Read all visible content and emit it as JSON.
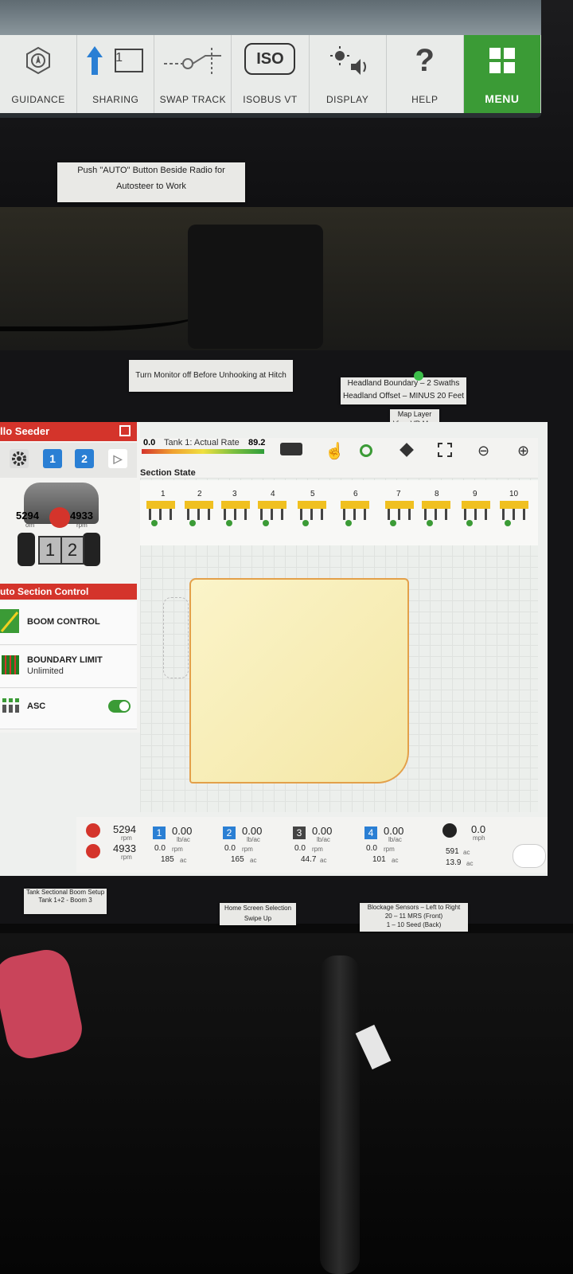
{
  "top_toolbar": {
    "buttons": [
      {
        "label": "GUIDANCE",
        "icon": "guidance-compass-icon"
      },
      {
        "label": "SHARING",
        "icon": "sharing-arrow-icon",
        "badge": "1"
      },
      {
        "label": "SWAP TRACK",
        "icon": "swap-track-icon"
      },
      {
        "label": "ISOBUS VT",
        "icon": "iso-icon",
        "icon_text": "ISO"
      },
      {
        "label": "DISPLAY",
        "icon": "display-brightness-icon"
      },
      {
        "label": "HELP",
        "icon": "help-question-icon",
        "icon_text": "?"
      },
      {
        "label": "MENU",
        "icon": "menu-grid-icon"
      }
    ]
  },
  "sticky_notes": {
    "autosteer_line1": "Push \"AUTO\" Button Beside Radio for",
    "autosteer_line2": "Autosteer to Work",
    "monitor_note": "Turn Monitor off Before Unhooking at Hitch",
    "headland_line1": "Headland Boundary – 2 Swaths",
    "headland_line2": "Headland Offset – MINUS 20 Feet",
    "map_layer_line1": "Map Layer",
    "map_layer_line2": "View VR Map",
    "tank_setup_line1": "Tank Sectional Boom Setup",
    "tank_setup_line2": "Tank 1+2  - Boom 3",
    "home_line1": "Home Screen Selection",
    "home_line2": "Swipe Up",
    "blockage_line1": "Blockage Sensors – Left to Right",
    "blockage_line2": "20 – 11 MRS (Front)",
    "blockage_line3": "1 – 10 Seed (Back)"
  },
  "left_panel": {
    "title": "llo Seeder",
    "tank_tabs": [
      "1",
      "2"
    ],
    "rpm_left": "5294",
    "rpm_right": "4933",
    "rpm_unit_left": "om",
    "rpm_unit_right": "rpm",
    "wheel_labels": [
      "1",
      "2"
    ],
    "asc_title": "uto Section Control",
    "boom_control": "BOOM CONTROL",
    "boundary_limit": "BOUNDARY LIMIT",
    "boundary_value": "Unlimited",
    "asc_label": "ASC"
  },
  "map": {
    "rate_value": "0.0",
    "rate_label": "Tank 1: Actual Rate",
    "rate_target": "89.2",
    "section_state_label": "Section State",
    "sections": [
      "1",
      "2",
      "3",
      "4",
      "5",
      "6",
      "7",
      "8",
      "9",
      "10"
    ]
  },
  "status_bar": {
    "fan1_rpm": "5294",
    "fan1_unit": "rpm",
    "fan2_rpm": "4933",
    "fan2_unit": "rpm",
    "tanks": [
      {
        "num": "1",
        "rate": "0.00",
        "unit": "lb/ac",
        "rpm": "0.0",
        "rpm_unit": "rpm",
        "area": "185",
        "area_unit": "ac"
      },
      {
        "num": "2",
        "rate": "0.00",
        "unit": "lb/ac",
        "rpm": "0.0",
        "rpm_unit": "rpm",
        "area": "165",
        "area_unit": "ac"
      },
      {
        "num": "3",
        "rate": "0.00",
        "unit": "lb/ac",
        "rpm": "0.0",
        "rpm_unit": "rpm",
        "area": "44.7",
        "area_unit": "ac"
      },
      {
        "num": "4",
        "rate": "0.00",
        "unit": "lb/ac",
        "rpm": "0.0",
        "rpm_unit": "rpm",
        "area": "101",
        "area_unit": "ac"
      }
    ],
    "speed": "0.0",
    "speed_unit": "mph",
    "total_area": "591",
    "total_area_unit": "ac",
    "total_area2": "13.9",
    "total_area2_unit": "ac"
  },
  "colors": {
    "accent_red": "#d4342b",
    "menu_green": "#3b9b36",
    "tank_blue": "#2a7fd4"
  }
}
